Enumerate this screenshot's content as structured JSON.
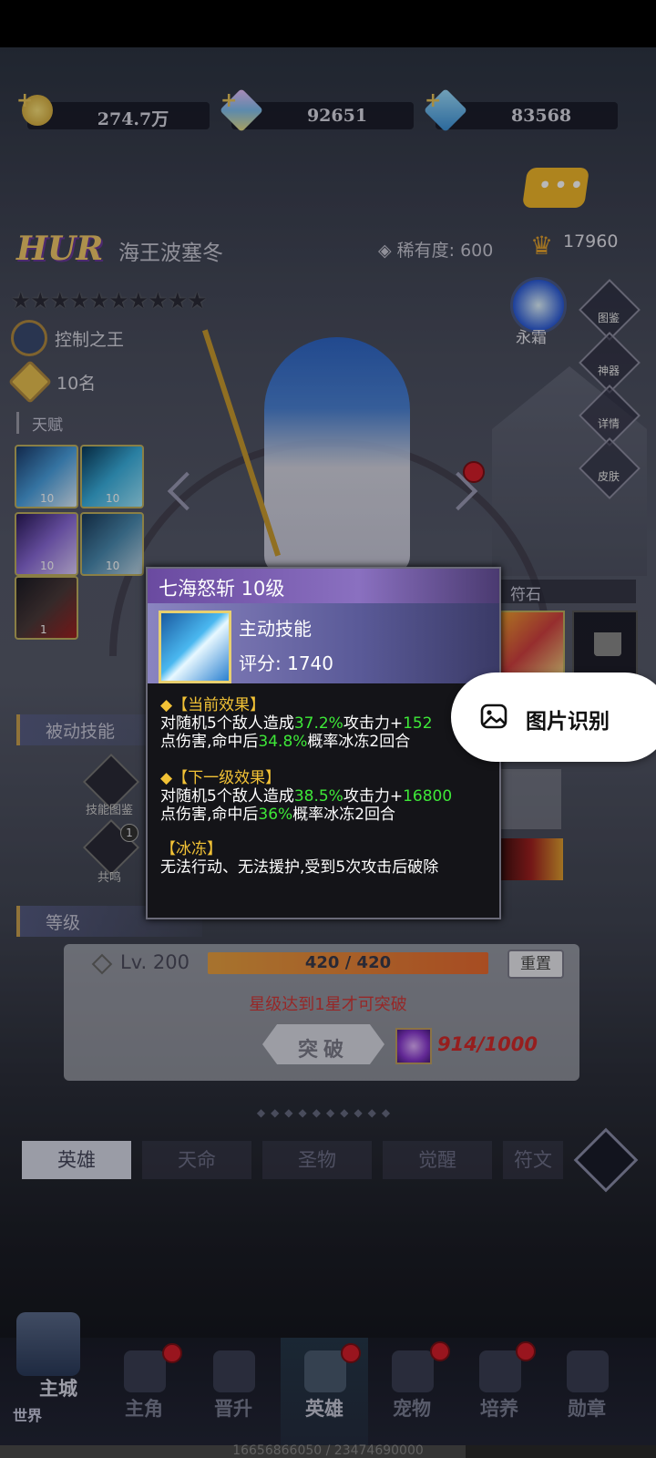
{
  "currency": [
    {
      "name": "gold",
      "value": "274.7万",
      "color": "#e8b840"
    },
    {
      "name": "crystal",
      "value": "92651",
      "color": "#c8a0e8"
    },
    {
      "name": "diamond",
      "value": "83568",
      "color": "#6ab8e8"
    }
  ],
  "hero": {
    "rank": "HUR",
    "name": "海王波塞冬",
    "rarity": "稀有度: 600",
    "power": "17960",
    "stars_filled": 0,
    "stars_total": 10,
    "title": "控制之王",
    "rank_place": "10名",
    "element": "永霜"
  },
  "sections": {
    "talent": "天赋",
    "rune": "符石",
    "passive": "被动技能",
    "level": "等级"
  },
  "talents": [
    {
      "level": "10"
    },
    {
      "level": "10"
    },
    {
      "level": "10"
    },
    {
      "level": "10"
    },
    {
      "level": "1"
    }
  ],
  "right_menu": [
    "图鉴",
    "神器",
    "详情",
    "皮肤"
  ],
  "passive_buttons": [
    "技能图鉴",
    "共鸣"
  ],
  "passive_badge": "1",
  "tooltip": {
    "title": "七海怒斩 10级",
    "type": "主动技能",
    "score": "评分: 1740",
    "current_header": "◆【当前效果】",
    "current_l1_a": "对随机5个敌人造成",
    "current_l1_pct": "37.2%",
    "current_l1_b": "攻击力+",
    "current_l1_num": "152",
    "current_l2_a": "点伤害,命中后",
    "current_l2_pct": "34.8%",
    "current_l2_b": "概率冰冻2回合",
    "next_header": "◆【下一级效果】",
    "next_l1_a": "对随机5个敌人造成",
    "next_l1_pct": "38.5%",
    "next_l1_b": "攻击力+",
    "next_l1_num": "16800",
    "next_l2_a": "点伤害,命中后",
    "next_l2_pct": "36%",
    "next_l2_b": "概率冰冻2回合",
    "freeze_header": "【冰冻】",
    "freeze_desc": "无法行动、无法援护,受到5次攻击后破除"
  },
  "ocr_button": "图片识别",
  "level": {
    "label": "Lv. 200",
    "xp": "420 / 420",
    "xp_fraction": 1.0,
    "reset": "重置",
    "star_requirement": "星级达到1星才可突破",
    "break_button": "突破",
    "material_count": "914/1000"
  },
  "tabs": [
    "英雄",
    "天命",
    "圣物",
    "觉醒",
    "符文"
  ],
  "active_tab": 0,
  "nav": [
    {
      "label": "主城",
      "sub": "世界",
      "dot": false
    },
    {
      "label": "主角",
      "dot": true
    },
    {
      "label": "晋升",
      "dot": false
    },
    {
      "label": "英雄",
      "dot": true
    },
    {
      "label": "宠物",
      "dot": true
    },
    {
      "label": "培养",
      "dot": true
    },
    {
      "label": "勋章",
      "dot": false
    }
  ],
  "exp_bar": {
    "text": "16656866050 / 23474690000",
    "fraction": 0.7096
  }
}
